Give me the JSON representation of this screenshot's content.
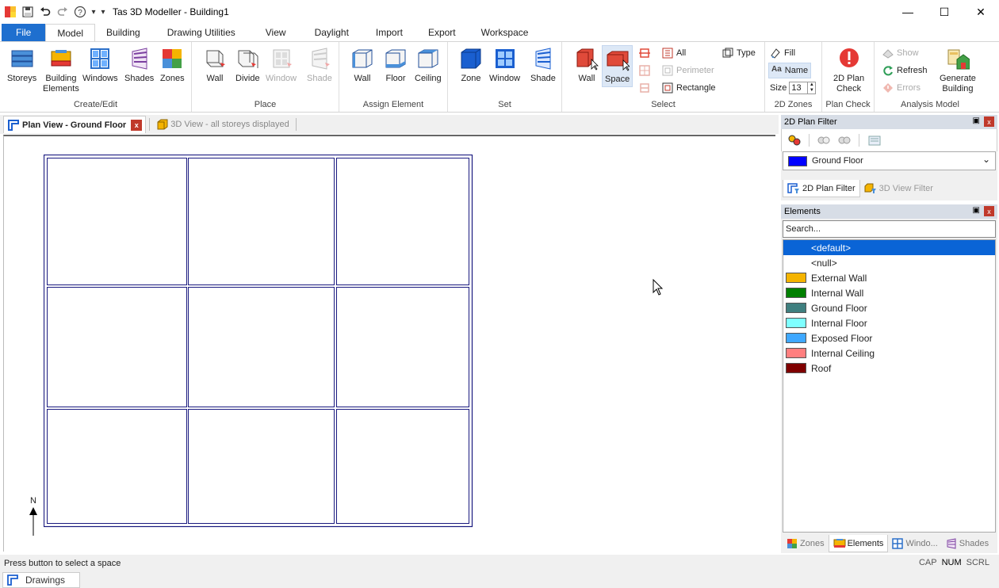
{
  "window": {
    "title": "Tas 3D Modeller - Building1",
    "minimize": "—",
    "maximize": "☐",
    "close": "✕"
  },
  "qat": {
    "customize": "▾",
    "help": "?",
    "dropdown": "▾"
  },
  "tabs": [
    "File",
    "Model",
    "Building",
    "Drawing Utilities",
    "View",
    "Daylight",
    "Import",
    "Export",
    "Workspace"
  ],
  "ribbon": {
    "create_edit": {
      "label": "Create/Edit",
      "storeys": "Storeys",
      "building_elements_1": "Building",
      "building_elements_2": "Elements",
      "windows": "Windows",
      "shades": "Shades",
      "zones": "Zones"
    },
    "place": {
      "label": "Place",
      "wall": "Wall",
      "divide": "Divide",
      "window": "Window",
      "shade": "Shade"
    },
    "assign": {
      "label": "Assign Element",
      "wall": "Wall",
      "floor": "Floor",
      "ceiling": "Ceiling"
    },
    "set": {
      "label": "Set",
      "zone": "Zone",
      "window": "Window",
      "shade": "Shade"
    },
    "select": {
      "label": "Select",
      "wall": "Wall",
      "space": "Space",
      "all": "All",
      "perimeter": "Perimeter",
      "rectangle": "Rectangle",
      "type": "Type"
    },
    "zones2d": {
      "label": "2D Zones",
      "fill": "Fill",
      "name": "Name",
      "size_label": "Size",
      "size_value": "13"
    },
    "plan_check": {
      "label": "Plan Check",
      "btn_1": "2D Plan",
      "btn_2": "Check"
    },
    "analysis": {
      "label": "Analysis Model",
      "show": "Show",
      "refresh": "Refresh",
      "errors": "Errors",
      "generate_1": "Generate",
      "generate_2": "Building"
    }
  },
  "doc_tabs": {
    "plan": "Plan View - Ground Floor",
    "close": "x",
    "view3d": "3D View - all storeys displayed"
  },
  "canvas": {
    "north": "N"
  },
  "plan_filter": {
    "title": "2D Plan Filter",
    "pin": "▣",
    "close": "x",
    "floor": "Ground Floor",
    "floor_color": "#0000ff",
    "chevron": "⌄",
    "tab_2d": "2D Plan Filter",
    "tab_3d": "3D View Filter"
  },
  "elements": {
    "title": "Elements",
    "pin": "▣",
    "close": "x",
    "search_placeholder": "Search...",
    "items": [
      {
        "label": "<default>",
        "color": ""
      },
      {
        "label": "<null>",
        "color": ""
      },
      {
        "label": "External Wall",
        "color": "#f5b400"
      },
      {
        "label": "Internal Wall",
        "color": "#008000"
      },
      {
        "label": "Ground Floor",
        "color": "#3f7f7f"
      },
      {
        "label": "Internal Floor",
        "color": "#7fffff"
      },
      {
        "label": "Exposed Floor",
        "color": "#3fa8ff"
      },
      {
        "label": "Internal Ceiling",
        "color": "#ff7f7f"
      },
      {
        "label": "Roof",
        "color": "#7f0000"
      }
    ],
    "bottom_tabs": [
      "Zones",
      "Elements",
      "Windo...",
      "Shades"
    ]
  },
  "status": {
    "message": "Press button to select a space",
    "cap": "CAP",
    "num": "NUM",
    "scrl": "SCRL"
  },
  "taskbar": {
    "drawings": "Drawings"
  }
}
